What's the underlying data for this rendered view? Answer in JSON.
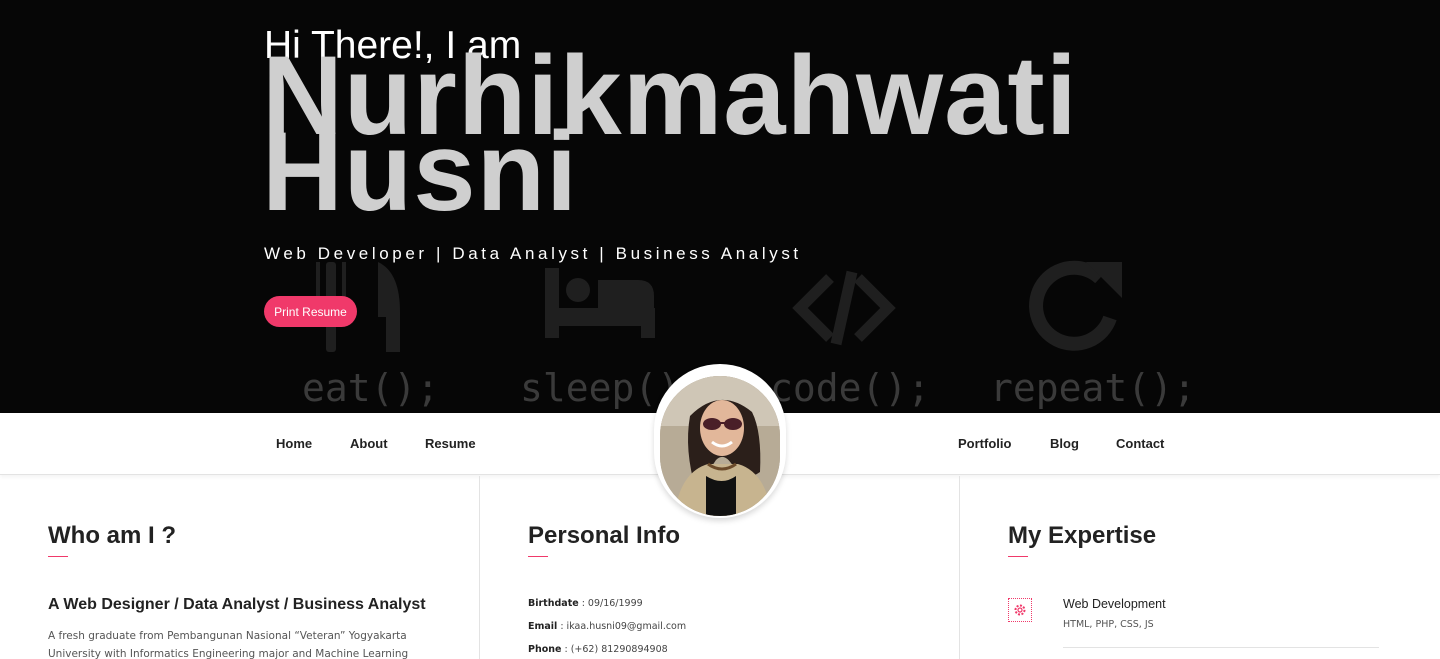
{
  "hero": {
    "greeting": "Hi There!, I am",
    "first_name": "Nurhikmahwati",
    "last_name": "Husni",
    "roles": "Web Developer | Data Analyst | Business Analyst",
    "print_button": "Print Resume",
    "background_words": [
      "eat();",
      "sleep();",
      "code();",
      "repeat();"
    ]
  },
  "nav": {
    "left": [
      "Home",
      "About",
      "Resume"
    ],
    "right": [
      "Portfolio",
      "Blog",
      "Contact"
    ]
  },
  "about": {
    "title": "Who am I ?",
    "subtitle": "A Web Designer / Data Analyst / Business Analyst",
    "text": "A fresh graduate from Pembangunan Nasional “Veteran” Yogyakarta University with Informatics Engineering major and Machine Learning concentration in"
  },
  "personal": {
    "title": "Personal Info",
    "items": [
      {
        "label": "Birthdate",
        "value": " : 09/16/1999"
      },
      {
        "label": "Email",
        "value": " : ikaa.husni09@gmail.com"
      },
      {
        "label": "Phone",
        "value": " : (+62) 81290894908"
      }
    ]
  },
  "expertise": {
    "title": "My Expertise",
    "items": [
      {
        "title": "Web Development",
        "sub": "HTML, PHP, CSS, JS",
        "icon": "gear-icon"
      }
    ]
  },
  "colors": {
    "accent": "#f0396a",
    "hero_bg": "#060606",
    "name": "#cfcfcf"
  }
}
